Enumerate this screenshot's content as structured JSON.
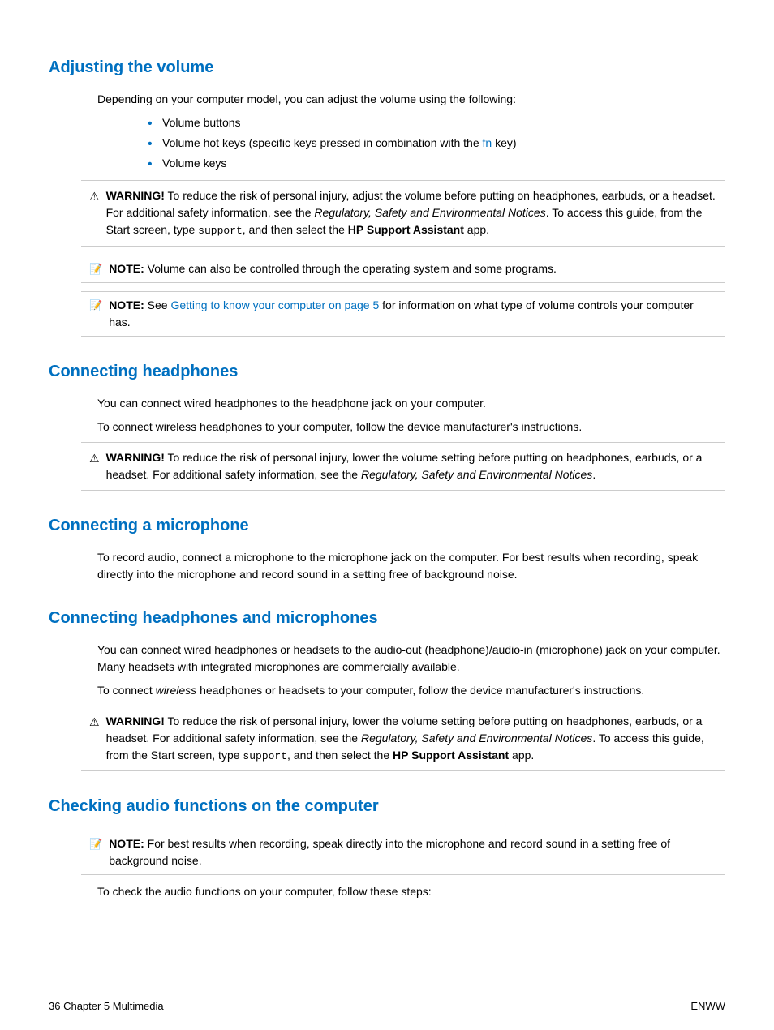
{
  "sections": [
    {
      "id": "adjusting-volume",
      "title": "Adjusting the volume",
      "intro": "Depending on your computer model, you can adjust the volume using the following:",
      "bullets": [
        "Volume buttons",
        "Volume hot keys (specific keys pressed in combination with the fn key)",
        "Volume keys"
      ],
      "warning": {
        "label": "WARNING!",
        "text_parts": [
          "To reduce the risk of personal injury, adjust the volume before putting on headphones, earbuds, or a headset. For additional safety information, see the ",
          "Regulatory, Safety and Environmental Notices",
          ". To access this guide, from the Start screen, type ",
          "support",
          ", and then select the ",
          "HP Support Assistant",
          " app."
        ]
      },
      "notes": [
        {
          "label": "NOTE:",
          "text": "Volume can also be controlled through the operating system and some programs."
        },
        {
          "label": "NOTE:",
          "link_text": "Getting to know your computer on page 5",
          "text": " for information on what type of volume controls your computer has.",
          "prefix": "See "
        }
      ]
    },
    {
      "id": "connecting-headphones",
      "title": "Connecting headphones",
      "paragraphs": [
        "You can connect wired headphones to the headphone jack on your computer.",
        "To connect wireless headphones to your computer, follow the device manufacturer's instructions."
      ],
      "warning": {
        "label": "WARNING!",
        "text_parts": [
          "To reduce the risk of personal injury, lower the volume setting before putting on headphones, earbuds, or a headset. For additional safety information, see the ",
          "Regulatory, Safety and Environmental Notices",
          "."
        ]
      }
    },
    {
      "id": "connecting-microphone",
      "title": "Connecting a microphone",
      "paragraphs": [
        "To record audio, connect a microphone to the microphone jack on the computer. For best results when recording, speak directly into the microphone and record sound in a setting free of background noise."
      ]
    },
    {
      "id": "connecting-headphones-microphones",
      "title": "Connecting headphones and microphones",
      "paragraphs": [
        "You can connect wired headphones or headsets to the audio-out (headphone)/audio-in (microphone) jack on your computer. Many headsets with integrated microphones are commercially available.",
        "To connect wireless headphones or headsets to your computer, follow the device manufacturer's instructions."
      ],
      "warning": {
        "label": "WARNING!",
        "text_parts": [
          "To reduce the risk of personal injury, lower the volume setting before putting on headphones, earbuds, or a headset. For additional safety information, see the ",
          "Regulatory, Safety and Environmental Notices",
          ". To access this guide, from the Start screen, type ",
          "support",
          ", and then select the ",
          "HP Support Assistant",
          " app."
        ]
      }
    },
    {
      "id": "checking-audio",
      "title": "Checking audio functions on the computer",
      "note": {
        "label": "NOTE:",
        "text": "For best results when recording, speak directly into the microphone and record sound in a setting free of background noise."
      },
      "paragraph": "To check the audio functions on your computer, follow these steps:"
    }
  ],
  "footer": {
    "left": "36    Chapter 5   Multimedia",
    "right": "ENWW"
  }
}
